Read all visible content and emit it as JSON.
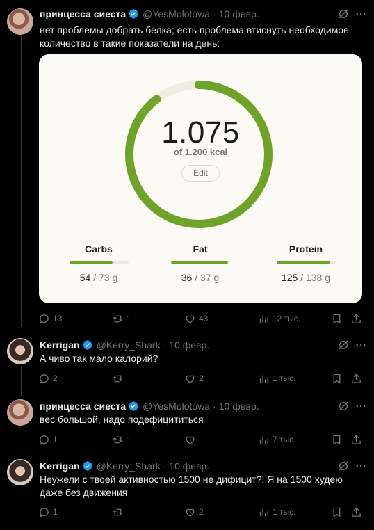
{
  "colors": {
    "accent": "#6ea327",
    "muted": "#71767b",
    "verified": "#1d9bf0"
  },
  "tweets": [
    {
      "name": "принцесса сиеста",
      "handle": "@YesMolotowa",
      "dot": "·",
      "date": "10 февр.",
      "text": "нет проблемы добрать белка; есть проблема втиснуть необходимое количество в такие показатели на день:",
      "reply": "13",
      "retweet": "1",
      "like": "43",
      "views": "12 тыс."
    },
    {
      "name": "Kerrigan",
      "handle": "@Kerry_Shark",
      "dot": "·",
      "date": "10 февр.",
      "text": "А чиво так мало калорий?",
      "reply": "2",
      "retweet": "",
      "like": "2",
      "views": "1 тыс."
    },
    {
      "name": "принцесса сиеста",
      "handle": "@YesMolotowa",
      "dot": "·",
      "date": "10 февр.",
      "text": "вес большой, надо подефицититься",
      "reply": "1",
      "retweet": "1",
      "like": "",
      "views": "7 тыс."
    },
    {
      "name": "Kerrigan",
      "handle": "@Kerry_Shark",
      "dot": "·",
      "date": "10 февр.",
      "text": "Неужели с твоей активностью 1500 не дифицит?! Я на 1500 худею даже без движения",
      "reply": "1",
      "retweet": "",
      "like": "2",
      "views": "1 тыс."
    }
  ],
  "card": {
    "calories": "1.075",
    "calories_sub": "of 1.200 kcal",
    "calories_fraction": 0.896,
    "edit_label": "Edit",
    "macros": [
      {
        "name": "Carbs",
        "current": "54",
        "sep": " / ",
        "goal": "73 g",
        "fraction": 0.74
      },
      {
        "name": "Fat",
        "current": "36",
        "sep": " / ",
        "goal": "37 g",
        "fraction": 0.97
      },
      {
        "name": "Protein",
        "current": "125",
        "sep": " / ",
        "goal": "138 g",
        "fraction": 0.91
      }
    ]
  }
}
